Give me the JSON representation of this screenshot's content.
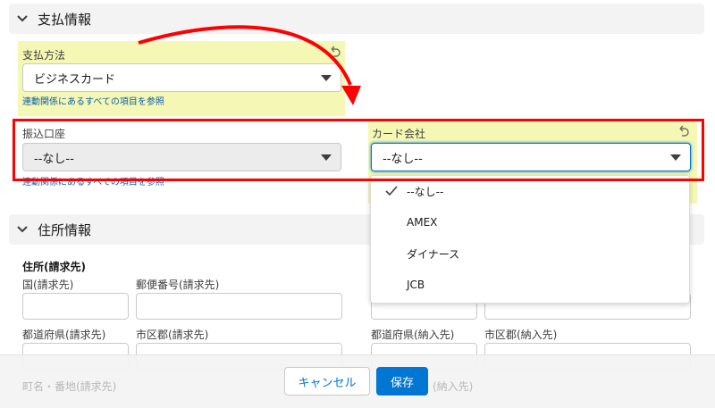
{
  "payment_section": {
    "title": "支払情報",
    "method_label": "支払方法",
    "method_value": "ビジネスカード",
    "method_link": "連動関係にあるすべての項目を参照",
    "bank_label": "振込口座",
    "bank_value": "--なし--",
    "bank_link": "連動関係にあるすべての項目を参照",
    "card_company_label": "カード会社",
    "card_company_value": "--なし--",
    "card_company_options": [
      {
        "label": "--なし--",
        "selected": true
      },
      {
        "label": "AMEX",
        "selected": false
      },
      {
        "label": "ダイナース",
        "selected": false
      },
      {
        "label": "JCB",
        "selected": false
      }
    ]
  },
  "address_section": {
    "title": "住所情報",
    "billing_heading": "住所(請求先)",
    "billing_country_label": "国(請求先)",
    "billing_postal_label": "郵便番号(請求先)",
    "billing_state_label": "都道府県(請求先)",
    "billing_city_label": "市区郡(請求先)",
    "billing_street_label": "町名・番地(請求先)",
    "shipping_state_label": "都道府県(納入先)",
    "shipping_city_label": "市区郡(納入先)",
    "shipping_street_fragment": "(納入先)"
  },
  "footer": {
    "cancel_label": "キャンセル",
    "save_label": "保存"
  },
  "colors": {
    "highlight": "#f4f8b4",
    "annotation_red": "#ff0000",
    "brand_blue": "#0176d3"
  },
  "icons": [
    "chevron-down-icon",
    "undo-icon",
    "caret-down-icon",
    "checkmark-icon",
    "curved-arrow-icon"
  ]
}
